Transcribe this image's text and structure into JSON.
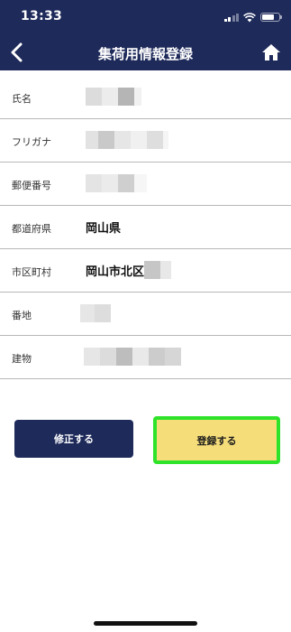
{
  "status_bar": {
    "time": "13:33",
    "icons": [
      "signal-icon",
      "wifi-icon",
      "battery-icon"
    ]
  },
  "nav": {
    "title": "集荷用情報登録",
    "back_icon": "chevron-left-icon",
    "home_icon": "home-icon",
    "background": "#1e2a5a"
  },
  "form": {
    "rows": [
      {
        "label": "氏名",
        "value": "",
        "redacted": true
      },
      {
        "label": "フリガナ",
        "value": "",
        "redacted": true
      },
      {
        "label": "郵便番号",
        "value": "",
        "redacted": true
      },
      {
        "label": "都道府県",
        "value": "岡山県",
        "redacted": false
      },
      {
        "label": "市区町村",
        "value": "岡山市北区",
        "redacted": true
      },
      {
        "label": "番地",
        "value": "",
        "redacted": true
      },
      {
        "label": "建物",
        "value": "",
        "redacted": true
      }
    ]
  },
  "buttons": {
    "edit": "修正する",
    "register": "登録する"
  },
  "colors": {
    "brand_navy": "#1e2a5a",
    "register_fill": "#f5dd7a",
    "highlight_border": "#2ee32a"
  }
}
